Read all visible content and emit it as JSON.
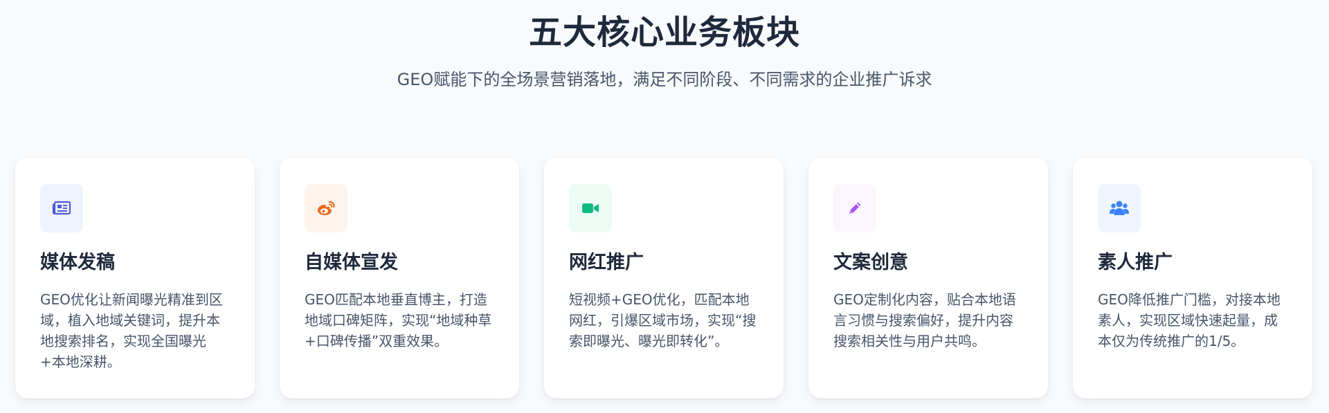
{
  "section": {
    "title": "五大核心业务板块",
    "subtitle": "GEO赋能下的全场景营销落地，满足不同阶段、不同需求的企业推广诉求"
  },
  "cards": [
    {
      "icon": "newspaper-icon",
      "icon_color": "#4f5bd5",
      "icon_bg": "#eff2ff",
      "title": "媒体发稿",
      "description": "GEO优化让新闻曝光精准到区域，植入地域关键词，提升本地搜索排名，实现全国曝光+本地深耕。"
    },
    {
      "icon": "weibo-icon",
      "icon_color": "#ea6a1a",
      "icon_bg": "#fff4ec",
      "title": "自媒体宣发",
      "description": "GEO匹配本地垂直博主，打造地域口碑矩阵，实现“地域种草+口碑传播”双重效果。"
    },
    {
      "icon": "video-camera-icon",
      "icon_color": "#10b981",
      "icon_bg": "#ecfdf5",
      "title": "网红推广",
      "description": "短视频+GEO优化，匹配本地网红，引爆区域市场，实现“搜索即曝光、曝光即转化”。"
    },
    {
      "icon": "pencil-icon",
      "icon_color": "#a855f7",
      "icon_bg": "#faf5ff",
      "title": "文案创意",
      "description": "GEO定制化内容，贴合本地语言习惯与搜索偏好，提升内容搜索相关性与用户共鸣。"
    },
    {
      "icon": "users-icon",
      "icon_color": "#3b82f6",
      "icon_bg": "#eff6ff",
      "title": "素人推广",
      "description": "GEO降低推广门槛，对接本地素人，实现区域快速起量，成本仅为传统推广的1/5。"
    }
  ]
}
